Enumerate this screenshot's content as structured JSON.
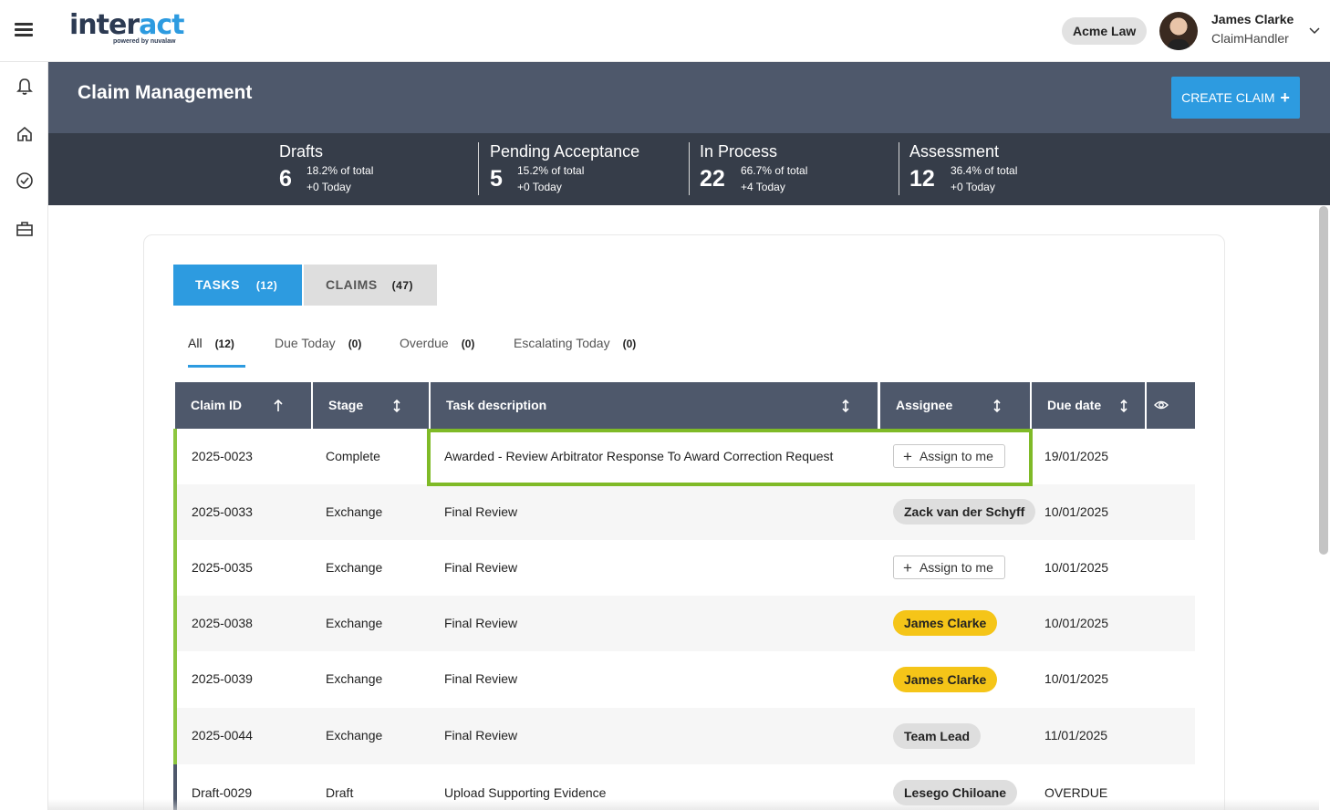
{
  "brand": {
    "name_prefix": "inter",
    "name_highlight": "act",
    "tagline": "powered by nuvalaw"
  },
  "topbar": {
    "org": "Acme Law",
    "user_name": "James Clarke",
    "user_role": "ClaimHandler"
  },
  "sidebar": {
    "items": [
      "bell-icon",
      "home-icon",
      "check-circle-icon",
      "briefcase-icon"
    ]
  },
  "header": {
    "title": "Claim Management",
    "create_label": "CREATE CLAIM"
  },
  "stats": [
    {
      "label": "Drafts",
      "count": "6",
      "pct": "18.2% of total",
      "today": "0 Today"
    },
    {
      "label": "Pending Acceptance",
      "count": "5",
      "pct": "15.2% of total",
      "today": "0 Today"
    },
    {
      "label": "In Process",
      "count": "22",
      "pct": "66.7% of total",
      "today": "4 Today"
    },
    {
      "label": "Assessment",
      "count": "12",
      "pct": "36.4% of total",
      "today": "0 Today"
    }
  ],
  "tabs": [
    {
      "label": "TASKS",
      "count": "(12)"
    },
    {
      "label": "CLAIMS",
      "count": "(47)"
    }
  ],
  "filters": [
    {
      "label": "All",
      "count": "(12)"
    },
    {
      "label": "Due Today",
      "count": "(0)"
    },
    {
      "label": "Overdue",
      "count": "(0)"
    },
    {
      "label": "Escalating Today",
      "count": "(0)"
    }
  ],
  "table": {
    "columns": [
      "Claim ID",
      "Stage",
      "Task description",
      "Assignee",
      "Due date"
    ],
    "assign_label": "Assign to me",
    "rows": [
      {
        "id": "2025-0023",
        "stage": "Complete",
        "task": "Awarded - Review Arbitrator Response To Award Correction Request",
        "assignee": "",
        "due": "19/01/2025"
      },
      {
        "id": "2025-0033",
        "stage": "Exchange",
        "task": "Final Review",
        "assignee": "Zack van der Schyff",
        "due": "10/01/2025"
      },
      {
        "id": "2025-0035",
        "stage": "Exchange",
        "task": "Final Review",
        "assignee": "",
        "due": "10/01/2025"
      },
      {
        "id": "2025-0038",
        "stage": "Exchange",
        "task": "Final Review",
        "assignee": "James Clarke",
        "due": "10/01/2025"
      },
      {
        "id": "2025-0039",
        "stage": "Exchange",
        "task": "Final Review",
        "assignee": "James Clarke",
        "due": "10/01/2025"
      },
      {
        "id": "2025-0044",
        "stage": "Exchange",
        "task": "Final Review",
        "assignee": "Team Lead",
        "due": "11/01/2025"
      },
      {
        "id": "Draft-0029",
        "stage": "Draft",
        "task": "Upload Supporting Evidence",
        "assignee": "Lesego Chiloane",
        "due": "OVERDUE"
      }
    ]
  },
  "colors": {
    "accent": "#2d9be0",
    "header": "#4e586b",
    "stats": "#363d49",
    "row_marker": "#8dc63f",
    "chip_self": "#f5c518",
    "highlight": "#7fba27"
  }
}
